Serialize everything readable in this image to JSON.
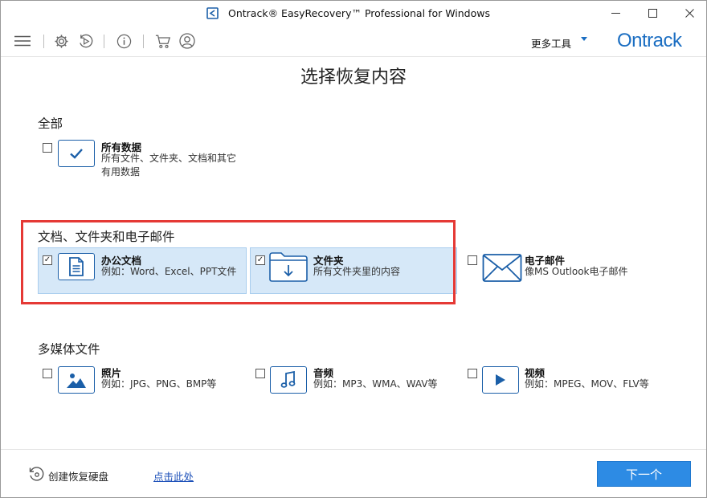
{
  "window": {
    "title": "Ontrack® EasyRecovery™ Professional for Windows",
    "minimize_icon": "minimize-icon",
    "maximize_icon": "maximize-icon",
    "close_icon": "close-icon"
  },
  "toolbar": {
    "icons": [
      "menu-icon",
      "gear-icon",
      "play-circle-icon",
      "info-icon",
      "cart-icon",
      "user-icon"
    ],
    "more_tools": "更多工具",
    "brand": "Ontrack"
  },
  "page_title": "选择恢复内容",
  "sections": {
    "all": {
      "title": "全部",
      "options": [
        {
          "title": "所有数据",
          "desc": "所有文件、文件夹、文档和其它有用数据",
          "checked": false,
          "icon": "checkmark-icon"
        }
      ]
    },
    "docs": {
      "title": "文档、文件夹和电子邮件",
      "options": [
        {
          "title": "办公文档",
          "desc": "例如：Word、Excel、PPT文件",
          "checked": true,
          "icon": "document-icon"
        },
        {
          "title": "文件夹",
          "desc": "所有文件夹里的内容",
          "checked": true,
          "icon": "folder-icon"
        },
        {
          "title": "电子邮件",
          "desc": "像MS Outlook电子邮件",
          "checked": false,
          "icon": "envelope-icon"
        }
      ]
    },
    "media": {
      "title": "多媒体文件",
      "options": [
        {
          "title": "照片",
          "desc": "例如：JPG、PNG、BMP等",
          "checked": false,
          "icon": "image-icon"
        },
        {
          "title": "音频",
          "desc": "例如：MP3、WMA、WAV等",
          "checked": false,
          "icon": "music-note-icon"
        },
        {
          "title": "视频",
          "desc": "例如：MPEG、MOV、FLV等",
          "checked": false,
          "icon": "play-icon"
        }
      ]
    }
  },
  "footer": {
    "create_disk": "创建恢复硬盘",
    "click_here": "点击此处",
    "next": "下一个"
  },
  "colors": {
    "accent": "#1b6ec2",
    "selected_bg": "#d6e8f8",
    "highlight_border": "#e53935",
    "next_button": "#2d8be4"
  },
  "check_glyph": "✓"
}
